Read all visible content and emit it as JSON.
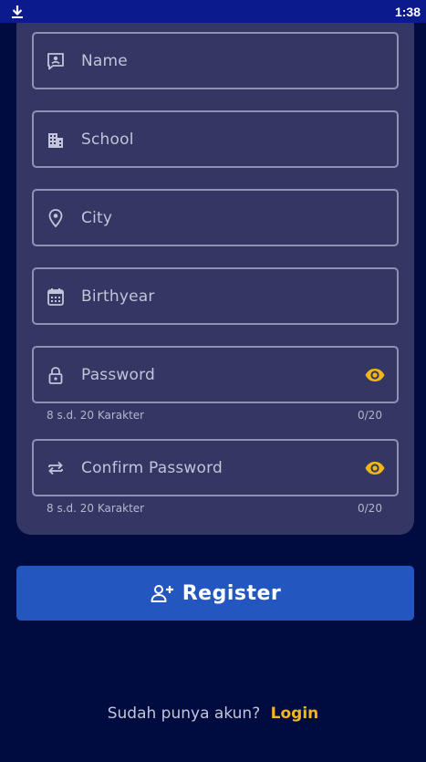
{
  "status_bar": {
    "time": "1:38",
    "left_icon": "download-icon"
  },
  "form": {
    "fields": [
      {
        "label": "Name",
        "icon": "contact-card-icon"
      },
      {
        "label": "School",
        "icon": "building-icon"
      },
      {
        "label": "City",
        "icon": "location-pin-icon"
      },
      {
        "label": "Birthyear",
        "icon": "calendar-icon"
      },
      {
        "label": "Password",
        "icon": "lock-icon",
        "helper": "8 s.d. 20 Karakter",
        "counter": "0/20"
      },
      {
        "label": "Confirm Password",
        "icon": "swap-icon",
        "helper": "8 s.d. 20 Karakter",
        "counter": "0/20"
      }
    ]
  },
  "register_button": {
    "label": "Register",
    "icon": "add-user-icon"
  },
  "login_prompt": {
    "question": "Sudah punya akun?",
    "link": "Login"
  },
  "colors": {
    "background": "#000c3f",
    "card": "#343663",
    "accent": "#f2b619",
    "button": "#2456bf"
  }
}
